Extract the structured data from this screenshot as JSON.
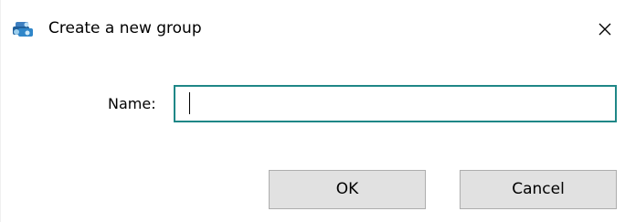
{
  "window": {
    "title": "Create a new group",
    "icon": "group-app-icon",
    "close_icon": "close-icon"
  },
  "form": {
    "name_label": "Name:",
    "name_value": "",
    "focus_color": "#1f8787"
  },
  "buttons": {
    "ok_label": "OK",
    "cancel_label": "Cancel"
  }
}
